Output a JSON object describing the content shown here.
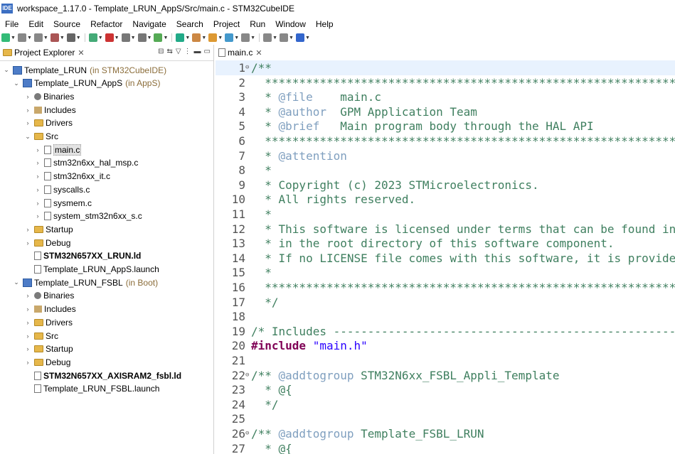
{
  "window": {
    "title": "workspace_1.17.0 - Template_LRUN_AppS/Src/main.c - STM32CubeIDE",
    "app_icon": "IDE"
  },
  "menu": [
    "File",
    "Edit",
    "Source",
    "Refactor",
    "Navigate",
    "Search",
    "Project",
    "Run",
    "Window",
    "Help"
  ],
  "explorer": {
    "tab_label": "Project Explorer",
    "rows": [
      {
        "label": "Template_LRUN",
        "qual": "(in STM32CubeIDE)",
        "icon": "project-icon",
        "chev": "v",
        "bold": false
      },
      {
        "label": "Template_LRUN_AppS",
        "qual": "(in AppS)",
        "icon": "project-icon",
        "chev": "v",
        "bold": false
      },
      {
        "label": "Binaries",
        "qual": "",
        "icon": "binaries-icon",
        "chev": ">",
        "bold": false
      },
      {
        "label": "Includes",
        "qual": "",
        "icon": "includes-icon",
        "chev": ">",
        "bold": false
      },
      {
        "label": "Drivers",
        "qual": "",
        "icon": "folder-icon",
        "chev": ">",
        "bold": false
      },
      {
        "label": "Src",
        "qual": "",
        "icon": "folder-icon",
        "chev": "v",
        "bold": false
      },
      {
        "label": "main.c",
        "qual": "",
        "icon": "c-file-icon",
        "chev": ">",
        "bold": false
      },
      {
        "label": "stm32n6xx_hal_msp.c",
        "qual": "",
        "icon": "c-file-icon",
        "chev": ">",
        "bold": false
      },
      {
        "label": "stm32n6xx_it.c",
        "qual": "",
        "icon": "c-file-icon",
        "chev": ">",
        "bold": false
      },
      {
        "label": "syscalls.c",
        "qual": "",
        "icon": "c-file-icon",
        "chev": ">",
        "bold": false
      },
      {
        "label": "sysmem.c",
        "qual": "",
        "icon": "c-file-icon",
        "chev": ">",
        "bold": false
      },
      {
        "label": "system_stm32n6xx_s.c",
        "qual": "",
        "icon": "c-file-icon",
        "chev": ">",
        "bold": false
      },
      {
        "label": "Startup",
        "qual": "",
        "icon": "folder-icon",
        "chev": ">",
        "bold": false
      },
      {
        "label": "Debug",
        "qual": "",
        "icon": "folder-icon",
        "chev": ">",
        "bold": false
      },
      {
        "label": "STM32N657XX_LRUN.ld",
        "qual": "",
        "icon": "ld-file-icon",
        "chev": "",
        "bold": true
      },
      {
        "label": "Template_LRUN_AppS.launch",
        "qual": "",
        "icon": "launch-file-icon",
        "chev": "",
        "bold": false
      },
      {
        "label": "Template_LRUN_FSBL",
        "qual": "(in Boot)",
        "icon": "project-icon",
        "chev": "v",
        "bold": false
      },
      {
        "label": "Binaries",
        "qual": "",
        "icon": "binaries-icon",
        "chev": ">",
        "bold": false
      },
      {
        "label": "Includes",
        "qual": "",
        "icon": "includes-icon",
        "chev": ">",
        "bold": false
      },
      {
        "label": "Drivers",
        "qual": "",
        "icon": "folder-icon",
        "chev": ">",
        "bold": false
      },
      {
        "label": "Src",
        "qual": "",
        "icon": "folder-icon",
        "chev": ">",
        "bold": false
      },
      {
        "label": "Startup",
        "qual": "",
        "icon": "folder-icon",
        "chev": ">",
        "bold": false
      },
      {
        "label": "Debug",
        "qual": "",
        "icon": "folder-icon",
        "chev": ">",
        "bold": false
      },
      {
        "label": "STM32N657XX_AXISRAM2_fsbl.ld",
        "qual": "",
        "icon": "ld-file-icon",
        "chev": "",
        "bold": true
      },
      {
        "label": "Template_LRUN_FSBL.launch",
        "qual": "",
        "icon": "launch-file-icon",
        "chev": "",
        "bold": false
      }
    ]
  },
  "editor": {
    "tab_label": "main.c",
    "lines": [
      {
        "n": "1",
        "fold": "-",
        "parts": [
          {
            "c": "cm",
            "t": "/**"
          }
        ]
      },
      {
        "n": "2",
        "fold": "",
        "parts": [
          {
            "c": "cm",
            "t": "  ******************************************************************************"
          }
        ]
      },
      {
        "n": "3",
        "fold": "",
        "parts": [
          {
            "c": "cm",
            "t": "  * "
          },
          {
            "c": "tag",
            "t": "@file"
          },
          {
            "c": "cm",
            "t": "    main.c"
          }
        ]
      },
      {
        "n": "4",
        "fold": "",
        "parts": [
          {
            "c": "cm",
            "t": "  * "
          },
          {
            "c": "tag",
            "t": "@author"
          },
          {
            "c": "cm",
            "t": "  GPM Application Team"
          }
        ]
      },
      {
        "n": "5",
        "fold": "",
        "parts": [
          {
            "c": "cm",
            "t": "  * "
          },
          {
            "c": "tag",
            "t": "@brief"
          },
          {
            "c": "cm",
            "t": "   Main program body through the HAL API"
          }
        ]
      },
      {
        "n": "6",
        "fold": "",
        "parts": [
          {
            "c": "cm",
            "t": "  ******************************************************************************"
          }
        ]
      },
      {
        "n": "7",
        "fold": "",
        "parts": [
          {
            "c": "cm",
            "t": "  * "
          },
          {
            "c": "tag",
            "t": "@attention"
          }
        ]
      },
      {
        "n": "8",
        "fold": "",
        "parts": [
          {
            "c": "cm",
            "t": "  *"
          }
        ]
      },
      {
        "n": "9",
        "fold": "",
        "parts": [
          {
            "c": "cm",
            "t": "  * Copyright (c) 2023 STMicroelectronics."
          }
        ]
      },
      {
        "n": "10",
        "fold": "",
        "parts": [
          {
            "c": "cm",
            "t": "  * All rights reserved."
          }
        ]
      },
      {
        "n": "11",
        "fold": "",
        "parts": [
          {
            "c": "cm",
            "t": "  *"
          }
        ]
      },
      {
        "n": "12",
        "fold": "",
        "parts": [
          {
            "c": "cm",
            "t": "  * This software is licensed under terms that can be found in the LICENSE file"
          }
        ]
      },
      {
        "n": "13",
        "fold": "",
        "parts": [
          {
            "c": "cm",
            "t": "  * in the root directory of this software component."
          }
        ]
      },
      {
        "n": "14",
        "fold": "",
        "parts": [
          {
            "c": "cm",
            "t": "  * If no LICENSE file comes with this software, it is provided AS-IS."
          }
        ]
      },
      {
        "n": "15",
        "fold": "",
        "parts": [
          {
            "c": "cm",
            "t": "  *"
          }
        ]
      },
      {
        "n": "16",
        "fold": "",
        "parts": [
          {
            "c": "cm",
            "t": "  ******************************************************************************"
          }
        ]
      },
      {
        "n": "17",
        "fold": "",
        "parts": [
          {
            "c": "cm",
            "t": "  */"
          }
        ]
      },
      {
        "n": "18",
        "fold": "",
        "parts": [
          {
            "c": "",
            "t": ""
          }
        ]
      },
      {
        "n": "19",
        "fold": "",
        "parts": [
          {
            "c": "cm",
            "t": "/* Includes ------------------------------------------------------------------*/"
          }
        ]
      },
      {
        "n": "20",
        "fold": "",
        "parts": [
          {
            "c": "kw",
            "t": "#include"
          },
          {
            "c": "",
            "t": " "
          },
          {
            "c": "str",
            "t": "\"main.h\""
          }
        ]
      },
      {
        "n": "21",
        "fold": "",
        "parts": [
          {
            "c": "",
            "t": ""
          }
        ]
      },
      {
        "n": "22",
        "fold": "-",
        "parts": [
          {
            "c": "cm",
            "t": "/** "
          },
          {
            "c": "tag",
            "t": "@addtogroup"
          },
          {
            "c": "cm",
            "t": " STM32N6xx_FSBL_Appli_Template"
          }
        ]
      },
      {
        "n": "23",
        "fold": "",
        "parts": [
          {
            "c": "cm",
            "t": "  * @{"
          }
        ]
      },
      {
        "n": "24",
        "fold": "",
        "parts": [
          {
            "c": "cm",
            "t": "  */"
          }
        ]
      },
      {
        "n": "25",
        "fold": "",
        "parts": [
          {
            "c": "",
            "t": ""
          }
        ]
      },
      {
        "n": "26",
        "fold": "-",
        "parts": [
          {
            "c": "cm",
            "t": "/** "
          },
          {
            "c": "tag",
            "t": "@addtogroup"
          },
          {
            "c": "cm",
            "t": " Template_FSBL_LRUN"
          }
        ]
      },
      {
        "n": "27",
        "fold": "",
        "parts": [
          {
            "c": "cm",
            "t": "  * @{"
          }
        ]
      }
    ]
  }
}
